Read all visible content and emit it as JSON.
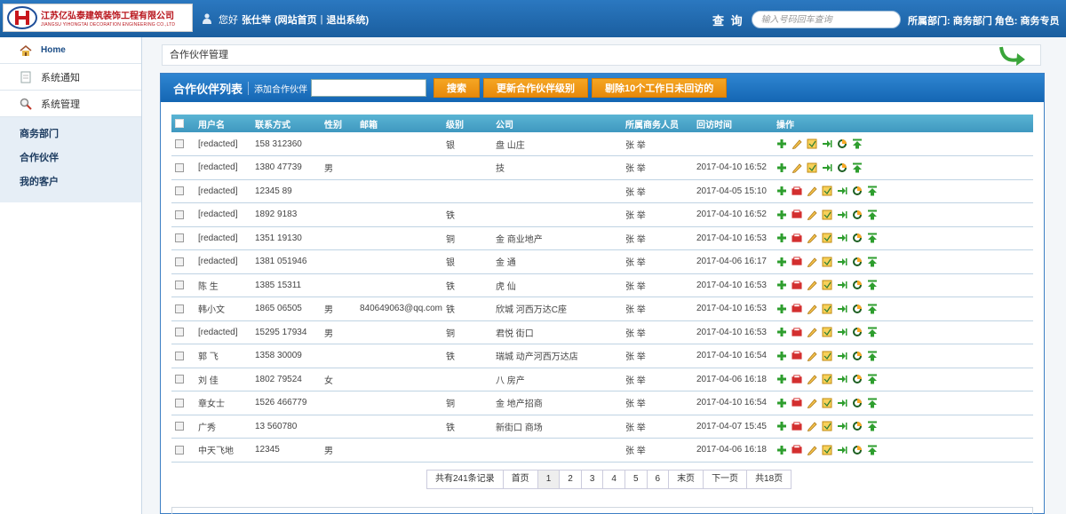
{
  "brand": {
    "name_cn": "江苏亿弘泰建筑装饰工程有限公司",
    "name_en": "JIANGSU YIHONGTAI DECORATION ENGINEERING CO.,LTD"
  },
  "header": {
    "greeting": "您好",
    "username": "张仕举",
    "link_site_home": "(网站首页",
    "sep": "|",
    "link_logout": "退出系统)",
    "search_label": "查 询",
    "search_placeholder": "输入号码回车查询",
    "dept_info": "所属部门: 商务部门 角色: 商务专员"
  },
  "sidebar": {
    "items": [
      {
        "label": "Home"
      },
      {
        "label": "系统通知"
      },
      {
        "label": "系统管理"
      }
    ],
    "sub_items": [
      {
        "label": "商务部门"
      },
      {
        "label": "合作伙伴"
      },
      {
        "label": "我的客户"
      }
    ]
  },
  "breadcrumb": "合作伙伴管理",
  "panel": {
    "title": "合作伙伴列表",
    "add_link": "添加合作伙伴",
    "search_button": "搜索",
    "update_level_button": "更新合作伙伴级别",
    "remove_button": "剔除10个工作日未回访的"
  },
  "table": {
    "columns": [
      "用户名",
      "联系方式",
      "性别",
      "邮箱",
      "级别",
      "公司",
      "所属商务人员",
      "回访时间",
      "操作"
    ],
    "rows": [
      {
        "user": "[redacted]",
        "phone": "158 312360",
        "sex": "",
        "email": "",
        "level": "银",
        "company": "盘 山庄",
        "staff": "张 举",
        "visit": "",
        "full_ops": false
      },
      {
        "user": "[redacted]",
        "phone": "1380 47739",
        "sex": "男",
        "email": "",
        "level": "",
        "company": "技",
        "staff": "张 举",
        "visit": "2017-04-10 16:52",
        "full_ops": false
      },
      {
        "user": "[redacted]",
        "phone": "12345 89",
        "sex": "",
        "email": "",
        "level": "",
        "company": "",
        "staff": "张 举",
        "visit": "2017-04-05 15:10",
        "full_ops": true
      },
      {
        "user": "[redacted]",
        "phone": "1892 9183",
        "sex": "",
        "email": "",
        "level": "铁",
        "company": "",
        "staff": "张 举",
        "visit": "2017-04-10 16:52",
        "full_ops": true
      },
      {
        "user": "[redacted]",
        "phone": "1351 19130",
        "sex": "",
        "email": "",
        "level": "铜",
        "company": "金 商业地产",
        "staff": "张 举",
        "visit": "2017-04-10 16:53",
        "full_ops": true
      },
      {
        "user": "[redacted]",
        "phone": "1381 051946",
        "sex": "",
        "email": "",
        "level": "银",
        "company": "金 通",
        "staff": "张 举",
        "visit": "2017-04-06 16:17",
        "full_ops": true
      },
      {
        "user": "陈 生",
        "phone": "1385 15311",
        "sex": "",
        "email": "",
        "level": "铁",
        "company": "虎 仙",
        "staff": "张 举",
        "visit": "2017-04-10 16:53",
        "full_ops": true
      },
      {
        "user": "韩小文",
        "phone": "1865 06505",
        "sex": "男",
        "email": "840649063@qq.com",
        "level": "铁",
        "company": "欣城 河西万达C座",
        "staff": "张 举",
        "visit": "2017-04-10 16:53",
        "full_ops": true
      },
      {
        "user": "[redacted]",
        "phone": "15295 17934",
        "sex": "男",
        "email": "",
        "level": "铜",
        "company": "君悦 街口",
        "staff": "张 举",
        "visit": "2017-04-10 16:53",
        "full_ops": true
      },
      {
        "user": "郭 飞",
        "phone": "1358 30009",
        "sex": "",
        "email": "",
        "level": "铁",
        "company": "瑞城 动产河西万达店",
        "staff": "张 举",
        "visit": "2017-04-10 16:54",
        "full_ops": true
      },
      {
        "user": "刘 佳",
        "phone": "1802 79524",
        "sex": "女",
        "email": "",
        "level": "",
        "company": "八 房产",
        "staff": "张 举",
        "visit": "2017-04-06 16:18",
        "full_ops": true
      },
      {
        "user": "章女士",
        "phone": "1526 466779",
        "sex": "",
        "email": "",
        "level": "铜",
        "company": "金 地产招商",
        "staff": "张 举",
        "visit": "2017-04-10 16:54",
        "full_ops": true
      },
      {
        "user": "广秀",
        "phone": "13 560780",
        "sex": "",
        "email": "",
        "level": "铁",
        "company": "新街口 商场",
        "staff": "张 举",
        "visit": "2017-04-07 15:45",
        "full_ops": true
      },
      {
        "user": "中天飞地",
        "phone": "12345",
        "sex": "男",
        "email": "",
        "level": "",
        "company": "",
        "staff": "张 举",
        "visit": "2017-04-06 16:18",
        "full_ops": true
      }
    ]
  },
  "pager": {
    "total": "共有241条记录",
    "first": "首页",
    "pages": [
      "1",
      "2",
      "3",
      "4",
      "5",
      "6"
    ],
    "last": "末页",
    "next": "下一页",
    "count": "共18页"
  },
  "colors": {
    "accent": "#1a6fbf",
    "button": "#f0a020",
    "table_head": "#4aa4c8"
  }
}
